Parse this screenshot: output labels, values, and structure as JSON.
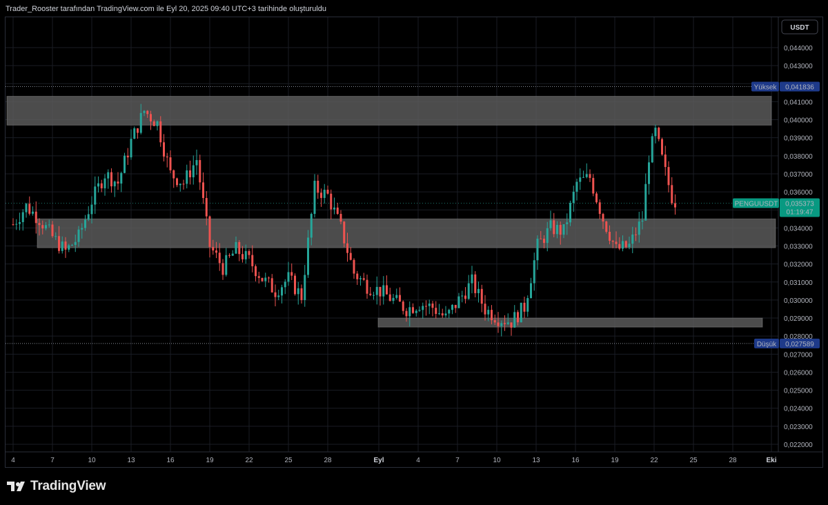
{
  "header": {
    "caption": "Trader_Rooster tarafından TradingView.com ile Eyl 20, 2025 09:40 UTC+3 tarihinde oluşturuldu"
  },
  "footer": {
    "brand": "TradingView"
  },
  "colors": {
    "up": "#26a69a",
    "down": "#ef5350",
    "zone": "#5d5d5d",
    "high_low_tag": "#1e3a8a",
    "price_tag": "#089981"
  },
  "chart_data": {
    "type": "candlestick",
    "symbol": "PENGUUSDT",
    "currency": "USDT",
    "ylim": [
      0.0215,
      0.0451
    ],
    "x_ticks": [
      "4",
      "7",
      "10",
      "13",
      "16",
      "19",
      "22",
      "25",
      "28",
      "Eyl",
      "4",
      "7",
      "10",
      "13",
      "16",
      "19",
      "22",
      "25",
      "28",
      "Eki"
    ],
    "y_ticks": [
      "0,044000",
      "0,043000",
      "0,042000",
      "0,041000",
      "0,040000",
      "0,039000",
      "0,038000",
      "0,037000",
      "0,036000",
      "0,035000",
      "0,034000",
      "0,033000",
      "0,032000",
      "0,031000",
      "0,030000",
      "0,029000",
      "0,028000",
      "0,027000",
      "0,026000",
      "0,025000",
      "0,024000",
      "0,023000",
      "0,022000"
    ],
    "high": {
      "label": "Yüksek",
      "value": "0,041836",
      "v": 0.041836
    },
    "low": {
      "label": "Düşük",
      "value": "0,027589",
      "v": 0.027589
    },
    "last": {
      "symbol": "PENGUUSDT",
      "price": "0,035373",
      "v": 0.035373,
      "countdown": "01:19:47"
    },
    "zones": [
      {
        "from_x": "4",
        "to_x": "28",
        "y_low": 0.0397,
        "y_high": 0.0413
      },
      {
        "from_x": "7",
        "to_x": "29",
        "y_low": 0.0329,
        "y_high": 0.0345
      },
      {
        "from_x": "Eyl",
        "to_x": "28",
        "y_low": 0.0285,
        "y_high": 0.029
      }
    ],
    "keyframes": [
      [
        0,
        0.0342
      ],
      [
        1,
        0.0352
      ],
      [
        2,
        0.0345
      ],
      [
        3,
        0.0335
      ],
      [
        4,
        0.0327
      ],
      [
        5,
        0.0335
      ],
      [
        6,
        0.0355
      ],
      [
        7,
        0.037
      ],
      [
        8,
        0.0365
      ],
      [
        9,
        0.0388
      ],
      [
        10,
        0.0405
      ],
      [
        11,
        0.0398
      ],
      [
        12,
        0.037
      ],
      [
        13,
        0.0365
      ],
      [
        14,
        0.0378
      ],
      [
        15,
        0.033
      ],
      [
        16,
        0.0318
      ],
      [
        17,
        0.0328
      ],
      [
        18,
        0.0322
      ],
      [
        19,
        0.0312
      ],
      [
        20,
        0.0305
      ],
      [
        21,
        0.0312
      ],
      [
        22,
        0.0302
      ],
      [
        23,
        0.0362
      ],
      [
        24,
        0.0358
      ],
      [
        25,
        0.034
      ],
      [
        26,
        0.0315
      ],
      [
        27,
        0.0308
      ],
      [
        28,
        0.0305
      ],
      [
        29,
        0.03
      ],
      [
        30,
        0.0295
      ],
      [
        31,
        0.0298
      ],
      [
        32,
        0.0296
      ],
      [
        33,
        0.029
      ],
      [
        34,
        0.03
      ],
      [
        35,
        0.031
      ],
      [
        36,
        0.0295
      ],
      [
        37,
        0.029
      ],
      [
        38,
        0.0288
      ],
      [
        39,
        0.0296
      ],
      [
        40,
        0.033
      ],
      [
        41,
        0.034
      ],
      [
        42,
        0.0338
      ],
      [
        43,
        0.0365
      ],
      [
        44,
        0.0368
      ],
      [
        45,
        0.0345
      ],
      [
        46,
        0.0328
      ],
      [
        47,
        0.033
      ],
      [
        48,
        0.0345
      ],
      [
        48.5,
        0.038
      ],
      [
        49,
        0.0393
      ],
      [
        49.7,
        0.0372
      ],
      [
        50.3,
        0.0356
      ],
      [
        50.6,
        0.0354
      ]
    ]
  }
}
